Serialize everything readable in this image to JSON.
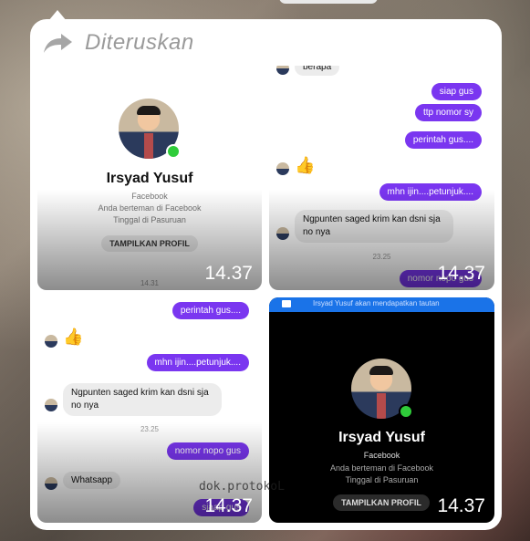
{
  "header": {
    "title": "Diteruskan",
    "icon": "forward-icon"
  },
  "tiles": {
    "t1": {
      "name": "Irsyad Yusuf",
      "sub1": "Facebook",
      "sub2": "Anda berteman di Facebook",
      "sub3": "Tinggal di Pasuruan",
      "button": "TAMPILKAN PROFIL",
      "stamp": "14.31",
      "time": "14.37"
    },
    "t2": {
      "top_partial": "berapa",
      "msgs_out": [
        "siap gus",
        "ttp nomor sy",
        "perintah gus....",
        "mhn ijin....petunjuk...."
      ],
      "msg_in": "Ngpunten saged krim kan dsni sja no nya",
      "stamp": "23.25",
      "last_out": "nomor nopo gus",
      "time": "14.37"
    },
    "t3": {
      "msgs_out": [
        "perintah gus....",
        "mhn ijin....petunjuk...."
      ],
      "msg_in": "Ngpunten saged krim kan dsni sja no nya",
      "stamp": "23.25",
      "out2": "nomor nopo gus",
      "in2": "Whatsapp",
      "last_out": "siaap gus",
      "watermark": "dok.protokoL",
      "time": "14.37"
    },
    "t4": {
      "banner": "Irsyad Yusuf akan mendapatkan tautan",
      "name": "Irsyad Yusuf",
      "sub1": "Facebook",
      "sub2": "Anda berteman di Facebook",
      "sub3": "Tinggal di Pasuruan",
      "button": "TAMPILKAN PROFIL",
      "time": "14.37"
    }
  },
  "colors": {
    "accent": "#7a36f0",
    "online": "#2fcc3a",
    "banner": "#1a73e8"
  }
}
